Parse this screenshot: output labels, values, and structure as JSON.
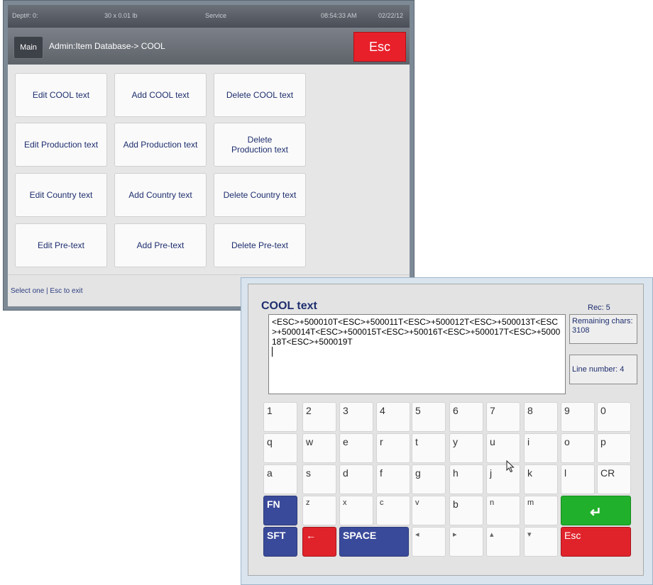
{
  "status_bar": {
    "dept": "Dept#: 0:",
    "weight": "30 x 0.01 lb",
    "mode": "Service",
    "time": "08:54:33 AM",
    "date": "02/22/12"
  },
  "header": {
    "main_label": "Main",
    "breadcrumb": "Admin:Item Database-> COOL",
    "esc_label": "Esc"
  },
  "tiles": [
    [
      "Edit COOL text",
      "Add COOL text",
      "Delete COOL text"
    ],
    [
      "Edit Production text",
      "Add Production text",
      "Delete Production text"
    ],
    [
      "Edit Country text",
      "Add Country text",
      "Delete Country text"
    ],
    [
      "Edit Pre-text",
      "Add Pre-text",
      "Delete Pre-text"
    ]
  ],
  "footer": {
    "hint": "Select one | Esc to exit"
  },
  "editor": {
    "title": "COOL text",
    "rec": "Rec: 5",
    "text": "<ESC>+500010T<ESC>+500011T<ESC>+500012T<ESC>+500013T<ESC>+500014T<ESC>+500015T<ESC>+50016T<ESC>+500017T<ESC>+500018T<ESC>+500019T",
    "remaining": "Remaining chars: 3108",
    "line_number": "Line number: 4"
  },
  "keyboard": {
    "row1": [
      "1",
      "2",
      "3",
      "4",
      "5",
      "6",
      "7",
      "8",
      "9",
      "0"
    ],
    "row2": [
      "q",
      "w",
      "e",
      "r",
      "t",
      "y",
      "u",
      "i",
      "o",
      "p"
    ],
    "row3": [
      "a",
      "s",
      "d",
      "f",
      "g",
      "h",
      "j",
      "k",
      "l",
      "CR"
    ],
    "row4": [
      "FN",
      "z",
      "x",
      "c",
      "v",
      "b",
      "n",
      "m",
      "↵"
    ],
    "row5": [
      "SFT",
      "←",
      "SPACE",
      "◂",
      "▸",
      "▴",
      "▾",
      "Esc"
    ]
  }
}
